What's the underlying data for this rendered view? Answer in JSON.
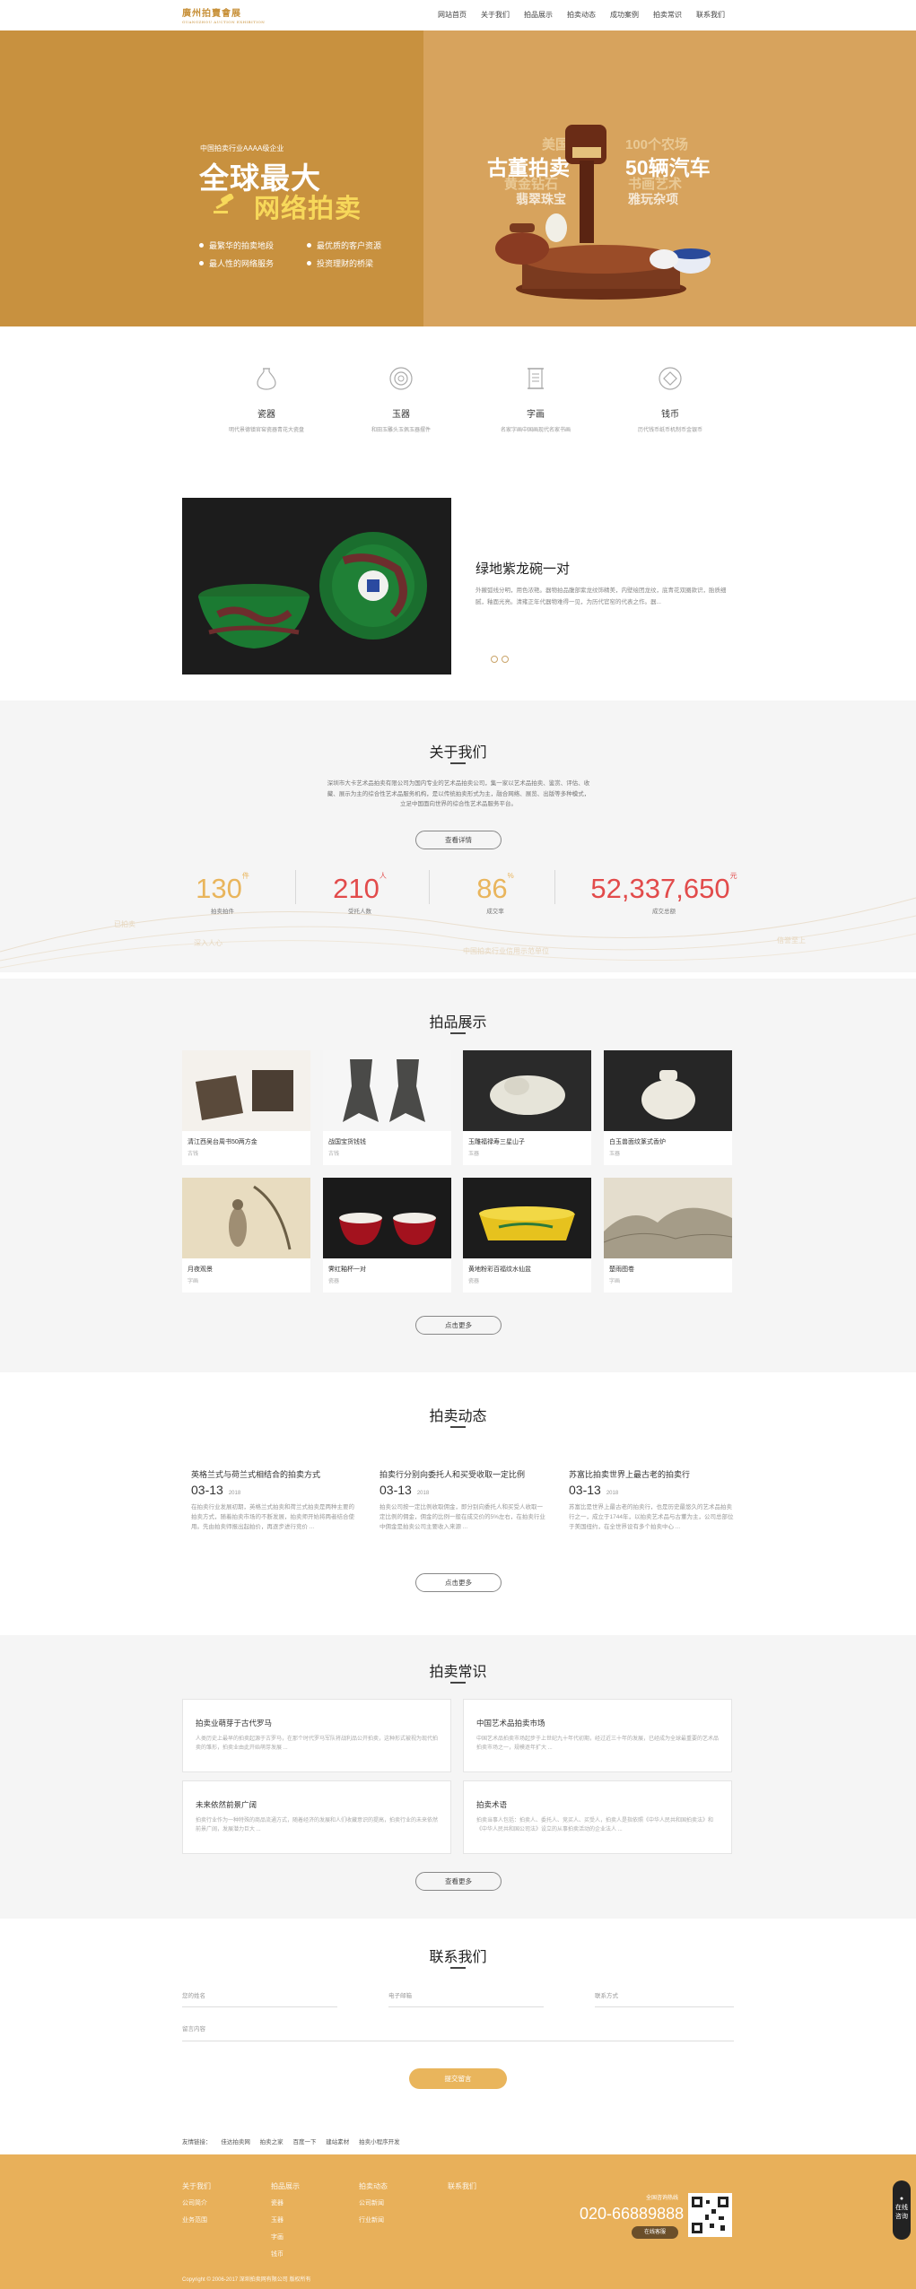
{
  "header": {
    "logo_main": "廣州拍賣會展",
    "logo_sub": "GUANGZHOU AUCTION EXHIBITION",
    "nav": [
      "网站首页",
      "关于我们",
      "拍品展示",
      "拍卖动态",
      "成功案例",
      "拍卖常识",
      "联系我们"
    ]
  },
  "banner": {
    "pre": "中国拍卖行业AAAA级企业",
    "big1": "全球最大",
    "big2": "网络拍卖",
    "bullets": [
      "最繁华的拍卖地段",
      "最优质的客户资源",
      "最人性的网络服务",
      "投资理财的桥梁"
    ],
    "words": {
      "w1": "美国名马",
      "w2": "古董拍卖",
      "w3": "黄金钻石",
      "w4": "翡翠珠宝",
      "w5": "100个农场",
      "w6": "50辆汽车",
      "w7": "书画艺术",
      "w8": "雅玩杂项"
    }
  },
  "categories": [
    {
      "icon": "vase-icon",
      "title": "瓷器",
      "desc": "明代景德镇官窑瓷器青花大瓷盘"
    },
    {
      "icon": "jade-disc-icon",
      "title": "玉器",
      "desc": "和田玉雕头玉佩玉器摆件"
    },
    {
      "icon": "scroll-icon",
      "title": "字画",
      "desc": "名家字画中国画现代名家书画"
    },
    {
      "icon": "coin-icon",
      "title": "钱币",
      "desc": "历代钱币纸币机制币金银币"
    }
  ],
  "featured": {
    "title": "绿地紫龙碗一对",
    "desc": "外撇弧线分明，用色浓艳。器物拍品腹部紫龙纹饰精美，内壁绘团龙纹，底青花双圈款识，胎质细腻，釉面光亮。清雍正年代器物难得一见，为历代官窑的代表之作。器..."
  },
  "about": {
    "title": "关于我们",
    "text": "深圳市大卡艺术品拍卖有限公司为国内专业的艺术品拍卖公司，集一家以艺术品拍卖、鉴赏、评估、收藏、展示为主的综合性艺术品服务机构，是以传统拍卖形式为主，融合网络、展览、出版等多种模式，立足中国面向世界的综合性艺术品服务平台。",
    "btn": "查看详情",
    "stats": [
      {
        "value": "130",
        "unit": "件",
        "label": "拍卖拍件",
        "color": "#e9b55c"
      },
      {
        "value": "210",
        "unit": "人",
        "label": "受托人数",
        "color": "#e24b4b"
      },
      {
        "value": "86",
        "unit": "%",
        "label": "成交率",
        "color": "#e9b55c"
      },
      {
        "value": "52,337,650",
        "unit": "元",
        "label": "成交总额",
        "color": "#e24b4b"
      }
    ],
    "ghost1": "已拍卖",
    "ghost2": "深入人心",
    "ghost3": "中国拍卖行业信用示范单位",
    "ghost4": "信誉至上"
  },
  "products": {
    "title": "拍品展示",
    "items": [
      {
        "title": "清江西吴台周书50两方金",
        "tag": "古钱"
      },
      {
        "title": "战国宝货钱钱",
        "tag": "古钱"
      },
      {
        "title": "玉雕福禄寿三星山子",
        "tag": "玉器"
      },
      {
        "title": "白玉兽面纹篆式香炉",
        "tag": "玉器"
      },
      {
        "title": "月夜观景",
        "tag": "字画"
      },
      {
        "title": "霁红釉杯一对",
        "tag": "瓷器"
      },
      {
        "title": "黄地粉彩百福纹水仙盆",
        "tag": "瓷器"
      },
      {
        "title": "楚雨图卷",
        "tag": "字画"
      }
    ],
    "btn": "点击更多"
  },
  "news": {
    "title": "拍卖动态",
    "items": [
      {
        "title": "英格兰式与荷兰式相结合的拍卖方式",
        "date": "03-13",
        "year": "2018",
        "desc": "在拍卖行业发展初期，英格兰式拍卖和荷兰式拍卖是两种主要的拍卖方式，随着拍卖市场的不断发展，拍卖师开始将两者结合使用。先由拍卖师报出起拍价，再逐步进行竞价 ..."
      },
      {
        "title": "拍卖行分别向委托人和买受收取一定比例",
        "date": "03-13",
        "year": "2018",
        "desc": "拍卖公司按一定比例收取佣金，即分别向委托人和买受人收取一定比例的佣金，佣金的比例一般在成交价的5%左右，在拍卖行业中佣金是拍卖公司主要收入来源 ..."
      },
      {
        "title": "苏富比拍卖世界上最古老的拍卖行",
        "date": "03-13",
        "year": "2018",
        "desc": "苏富比是世界上最古老的拍卖行，也是历史最悠久的艺术品拍卖行之一，成立于1744年，以拍卖艺术品与古董为主，公司总部位于美国纽约，在全世界设有多个拍卖中心 ..."
      }
    ],
    "btn": "点击更多"
  },
  "tips": {
    "title": "拍卖常识",
    "items": [
      {
        "title": "拍卖业萌芽于古代罗马",
        "desc": "人类历史上最早的拍卖起源于古罗马，在那个时代罗马军队将战利品公开拍卖，这种形式被视为现代拍卖的雏形，拍卖业由此开始萌芽发展 ..."
      },
      {
        "title": "中国艺术品拍卖市场",
        "desc": "中国艺术品拍卖市场起步于上世纪九十年代初期，经过近三十年的发展，已经成为全球最重要的艺术品拍卖市场之一，规模逐年扩大 ..."
      },
      {
        "title": "未来依然前景广阔",
        "desc": "拍卖行业作为一种特殊的商品流通方式，随着经济的发展和人们收藏意识的提高，拍卖行业的未来依然前景广阔，发展潜力巨大 ..."
      },
      {
        "title": "拍卖术语",
        "desc": "拍卖当事人包括：拍卖人、委托人、竞买人、买受人，拍卖人是指依照《中华人民共和国拍卖法》和《中华人民共和国公司法》设立的从事拍卖活动的企业法人 ..."
      }
    ],
    "btn": "查看更多"
  },
  "contact": {
    "title": "联系我们",
    "name_ph": "您的姓名",
    "email_ph": "电子邮箱",
    "phone_ph": "联系方式",
    "msg_ph": "留言内容",
    "submit": "提交留言"
  },
  "links": {
    "label": "友情链接：",
    "items": [
      "佳达拍卖网",
      "拍卖之家",
      "百度一下",
      "建站素材",
      "拍卖小程序开发"
    ]
  },
  "footer": {
    "cols": [
      {
        "head": "关于我们",
        "items": [
          "公司简介",
          "业务范围"
        ]
      },
      {
        "head": "拍品展示",
        "items": [
          "瓷器",
          "玉器",
          "字画",
          "钱币"
        ]
      },
      {
        "head": "拍卖动态",
        "items": [
          "公司新闻",
          "行业新闻"
        ]
      },
      {
        "head": "联系我们",
        "items": []
      }
    ],
    "phone_label": "全国咨询热线",
    "phone": "020-66889888",
    "online": "在线客服",
    "copyright": "Copyright © 2006-2017 深圳拍卖网有限公司 版权所有",
    "side": "在线咨询"
  }
}
